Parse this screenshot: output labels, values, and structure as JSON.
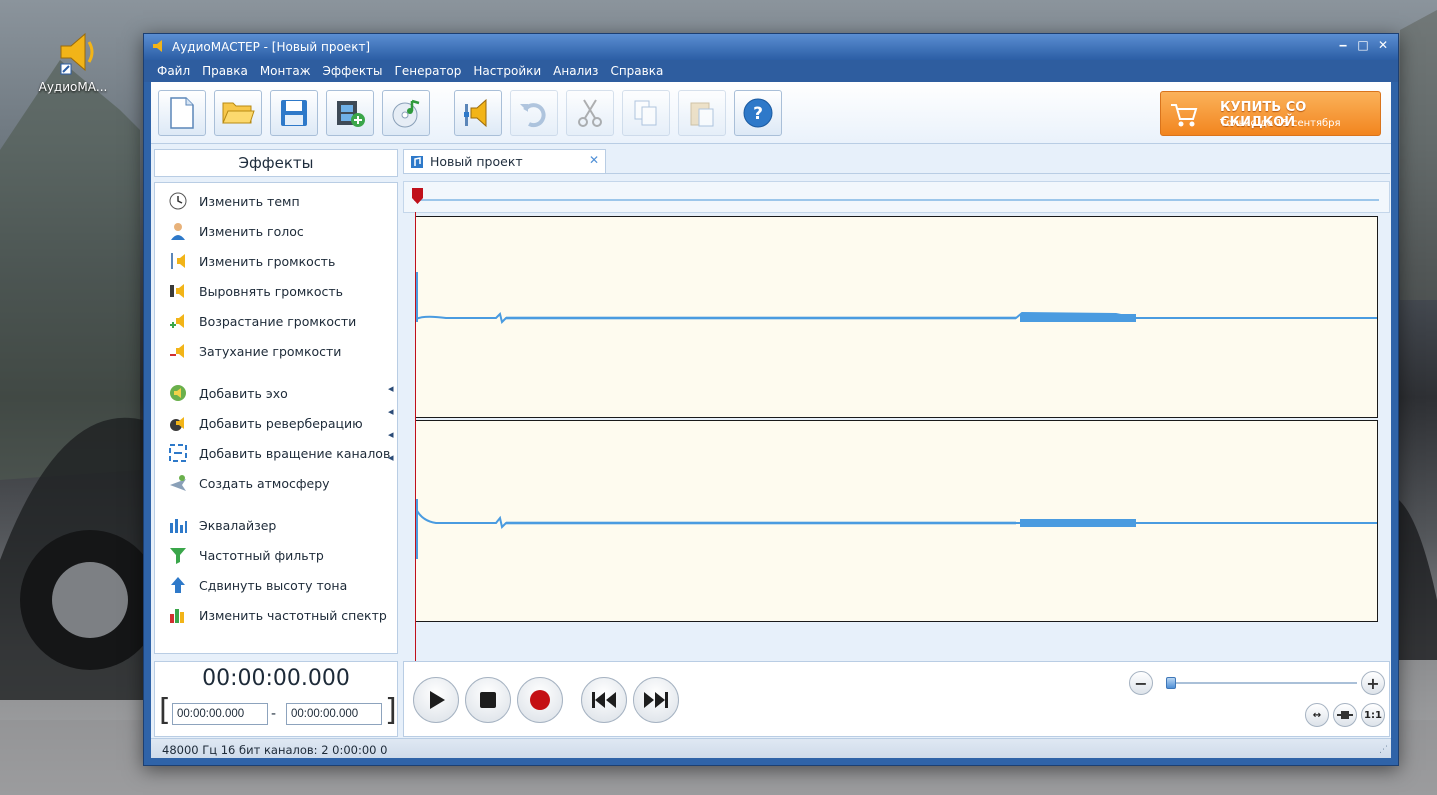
{
  "desktop": {
    "icon_label": "АудиоМА..."
  },
  "window": {
    "title": "АудиоМАСТЕР - [Новый проект]",
    "controls": [
      "‒",
      "□",
      "✕"
    ]
  },
  "menu": [
    "Файл",
    "Правка",
    "Монтаж",
    "Эффекты",
    "Генератор",
    "Настройки",
    "Анализ",
    "Справка"
  ],
  "toolbar": {
    "buttons": [
      "new-file-icon",
      "open-folder-icon",
      "save-icon",
      "add-video-icon",
      "cd-music-icon",
      "volume-icon",
      "undo-icon",
      "cut-icon",
      "copy-icon",
      "paste-icon",
      "help-icon"
    ],
    "buy_title": "КУПИТЬ СО СКИДКОЙ",
    "buy_subtitle": "Только до 15 сентября"
  },
  "effects": {
    "title": "Эффекты",
    "items": [
      "Изменить темп",
      "Изменить голос",
      "Изменить громкость",
      "Выровнять громкость",
      "Возрастание громкости",
      "Затухание громкости",
      "Добавить эхо",
      "Добавить реверберацию",
      "Добавить вращение каналов",
      "Создать атмосферу",
      "Эквалайзер",
      "Частотный фильтр",
      "Сдвинуть высоту тона",
      "Изменить частотный спектр"
    ]
  },
  "tab": {
    "label": "Новый проект"
  },
  "time": {
    "current": "00:00:00.000",
    "start": "00:00:00.000",
    "end": "00:00:00.000",
    "dash": "-",
    "open_bracket": "[",
    "close_bracket": "]"
  },
  "zoom": {
    "minus": "−",
    "plus": "+",
    "fit": "↔",
    "ratio": "1:1"
  },
  "status": {
    "text": "48000 Гц  16 бит  каналов: 2   0:00:00 0"
  },
  "colors": {
    "accent": "#2f63a8",
    "waveform": "#4a9be0",
    "wave_bg": "#fefbef",
    "buy": "#f2851f"
  }
}
